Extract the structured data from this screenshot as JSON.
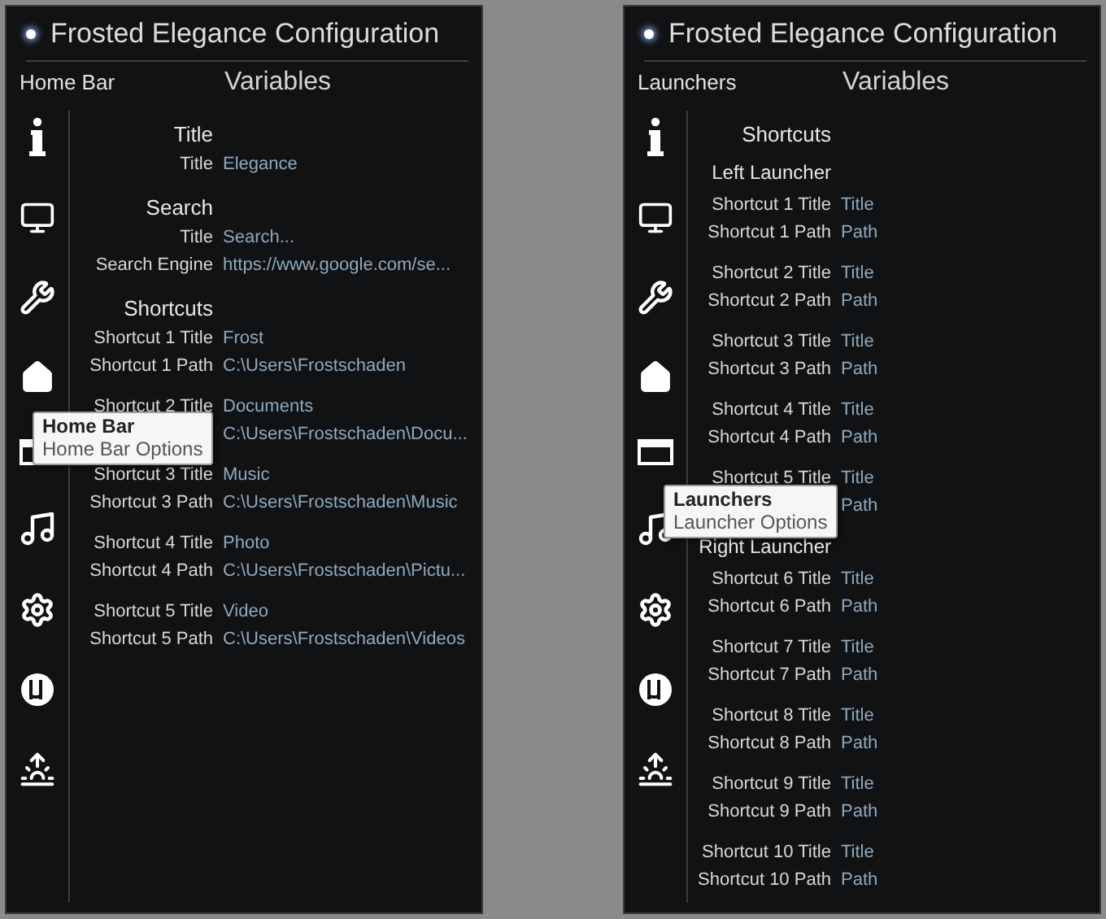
{
  "windows": [
    {
      "title": "Frosted Elegance Configuration",
      "section": "Home Bar",
      "column_heading": "Variables",
      "sidebar": [
        {
          "kind": "info"
        },
        {
          "kind": "monitor"
        },
        {
          "kind": "tools"
        },
        {
          "kind": "home"
        },
        {
          "kind": "bar"
        },
        {
          "kind": "music"
        },
        {
          "kind": "gear"
        },
        {
          "kind": "torrent"
        },
        {
          "kind": "sunrise"
        }
      ],
      "content": [
        {
          "kind": "heading",
          "text": "Title"
        },
        {
          "kind": "group",
          "rows": [
            {
              "label": "Title",
              "value": "Elegance"
            }
          ]
        },
        {
          "kind": "heading",
          "text": "Search"
        },
        {
          "kind": "group",
          "rows": [
            {
              "label": "Title",
              "value": "Search..."
            },
            {
              "label": "Search Engine",
              "value": "https://www.google.com/se..."
            }
          ]
        },
        {
          "kind": "heading",
          "text": "Shortcuts"
        },
        {
          "kind": "group",
          "rows": [
            {
              "label": "Shortcut 1 Title",
              "value": "Frost"
            },
            {
              "label": "Shortcut 1 Path",
              "value": "C:\\Users\\Frostschaden"
            }
          ]
        },
        {
          "kind": "group",
          "rows": [
            {
              "label": "Shortcut 2 Title",
              "value": "Documents"
            },
            {
              "value": "C:\\Users\\Frostschaden\\Docu..."
            }
          ]
        },
        {
          "kind": "group",
          "rows": [
            {
              "label": "Shortcut 3 Title",
              "value": "Music"
            },
            {
              "label": "Shortcut 3 Path",
              "value": "C:\\Users\\Frostschaden\\Music"
            }
          ]
        },
        {
          "kind": "group",
          "rows": [
            {
              "label": "Shortcut 4 Title",
              "value": "Photo"
            },
            {
              "label": "Shortcut 4 Path",
              "value": "C:\\Users\\Frostschaden\\Pictu..."
            }
          ]
        },
        {
          "kind": "group",
          "rows": [
            {
              "label": "Shortcut 5 Title",
              "value": "Video"
            },
            {
              "label": "Shortcut 5 Path",
              "value": "C:\\Users\\Frostschaden\\Videos"
            }
          ]
        }
      ],
      "tooltip": {
        "title": "Home Bar",
        "text": "Home Bar Options"
      }
    },
    {
      "title": "Frosted Elegance Configuration",
      "section": "Launchers",
      "column_heading": "Variables",
      "sidebar": [
        {
          "kind": "info"
        },
        {
          "kind": "monitor"
        },
        {
          "kind": "tools"
        },
        {
          "kind": "home"
        },
        {
          "kind": "bar"
        },
        {
          "kind": "music"
        },
        {
          "kind": "gear"
        },
        {
          "kind": "torrent"
        },
        {
          "kind": "sunrise"
        }
      ],
      "content": [
        {
          "kind": "heading",
          "text": "Shortcuts"
        },
        {
          "kind": "subheading",
          "text": "Left Launcher"
        },
        {
          "kind": "group",
          "rows": [
            {
              "label": "Shortcut 1 Title",
              "value": "Title"
            },
            {
              "label": "Shortcut 1 Path",
              "value": "Path"
            }
          ]
        },
        {
          "kind": "group",
          "rows": [
            {
              "label": "Shortcut 2 Title",
              "value": "Title"
            },
            {
              "label": "Shortcut 2 Path",
              "value": "Path"
            }
          ]
        },
        {
          "kind": "group",
          "rows": [
            {
              "label": "Shortcut 3 Title",
              "value": "Title"
            },
            {
              "label": "Shortcut 3 Path",
              "value": "Path"
            }
          ]
        },
        {
          "kind": "group",
          "rows": [
            {
              "label": "Shortcut 4 Title",
              "value": "Title"
            },
            {
              "label": "Shortcut 4 Path",
              "value": "Path"
            }
          ]
        },
        {
          "kind": "group",
          "rows": [
            {
              "label": "Shortcut 5 Title",
              "value": "Title"
            },
            {
              "value": "Path"
            }
          ]
        },
        {
          "kind": "subheading",
          "text": "Right Launcher"
        },
        {
          "kind": "group",
          "rows": [
            {
              "label": "Shortcut 6 Title",
              "value": "Title"
            },
            {
              "label": "Shortcut 6 Path",
              "value": "Path"
            }
          ]
        },
        {
          "kind": "group",
          "rows": [
            {
              "label": "Shortcut 7 Title",
              "value": "Title"
            },
            {
              "label": "Shortcut 7 Path",
              "value": "Path"
            }
          ]
        },
        {
          "kind": "group",
          "rows": [
            {
              "label": "Shortcut 8 Title",
              "value": "Title"
            },
            {
              "label": "Shortcut 8 Path",
              "value": "Path"
            }
          ]
        },
        {
          "kind": "group",
          "rows": [
            {
              "label": "Shortcut 9 Title",
              "value": "Title"
            },
            {
              "label": "Shortcut 9 Path",
              "value": "Path"
            }
          ]
        },
        {
          "kind": "group",
          "rows": [
            {
              "label": "Shortcut 10 Title",
              "value": "Title"
            },
            {
              "label": "Shortcut 10 Path",
              "value": "Path"
            }
          ]
        }
      ],
      "tooltip": {
        "title": "Launchers",
        "text": "Launcher Options"
      }
    }
  ]
}
